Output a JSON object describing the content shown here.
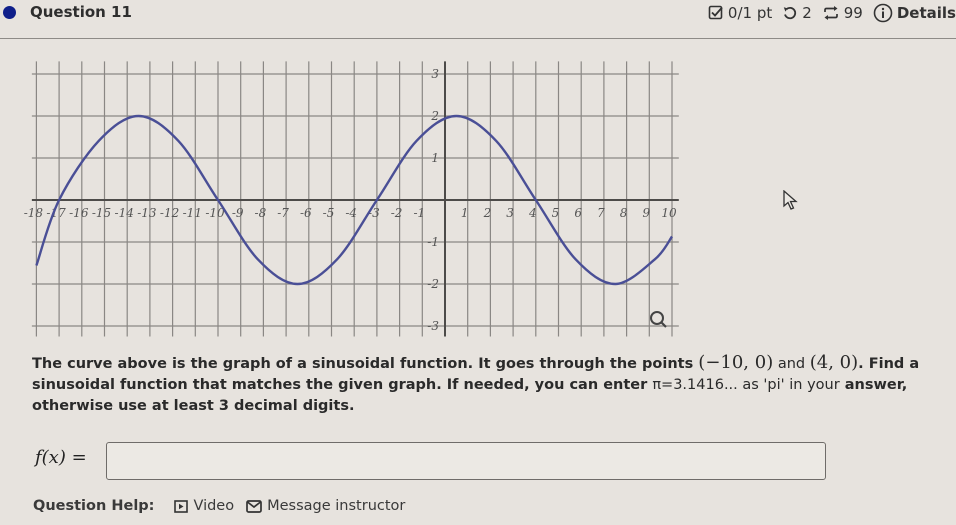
{
  "header": {
    "question_title": "Question 11",
    "score": "0/1 pt",
    "retries": "2",
    "attempts": "99",
    "details_label": "Details",
    "icons": {
      "status": "filled-circle-icon",
      "score": "checkbox-icon",
      "retry": "undo-icon",
      "attempts": "repeat-icon",
      "details": "info-icon"
    }
  },
  "chart_data": {
    "type": "line",
    "title": "",
    "xlabel": "",
    "ylabel": "",
    "xlim": [
      -18,
      10
    ],
    "ylim": [
      -3,
      3
    ],
    "grid": true,
    "x_ticks": [
      -18,
      -17,
      -16,
      -15,
      -14,
      -13,
      -12,
      -11,
      -10,
      -9,
      -8,
      -7,
      -6,
      -5,
      -4,
      -3,
      -2,
      -1,
      1,
      2,
      3,
      4,
      5,
      6,
      7,
      8,
      9,
      10
    ],
    "y_ticks": [
      -3,
      -2,
      -1,
      1,
      2,
      3
    ],
    "series": [
      {
        "name": "sinusoid",
        "function": "2*sin(pi/7*(x+3))",
        "x": [
          -18,
          -17,
          -15.25,
          -13.5,
          -11.75,
          -10,
          -8.25,
          -6.5,
          -4.75,
          -3,
          -1.25,
          0.5,
          2.25,
          4,
          5.75,
          7.5,
          9.25,
          10
        ],
        "y": [
          -1.56,
          0,
          1.41,
          2,
          1.41,
          0,
          -1.41,
          -2,
          -1.41,
          0,
          1.41,
          2,
          1.41,
          0,
          -1.41,
          -2,
          -1.41,
          -0.87
        ],
        "color": "#4a4f96"
      }
    ],
    "magnifier_icon": "magnifier-icon"
  },
  "prompt": {
    "part1": "The curve above is the graph of a sinusoidal function. It goes through the points ",
    "point1": "(−10, 0)",
    "and": " and ",
    "point2": "(4, 0)",
    "part2": ". Find a sinusoidal function that matches the given graph. If needed, you can enter ",
    "pi_text": "π=3.1416... as 'pi' in your",
    "part3": " answer, otherwise use at least 3 decimal digits."
  },
  "answer": {
    "label": "f(x) =",
    "value": "",
    "placeholder": ""
  },
  "help": {
    "label": "Question Help:",
    "video_label": "Video",
    "message_label": "Message instructor"
  }
}
